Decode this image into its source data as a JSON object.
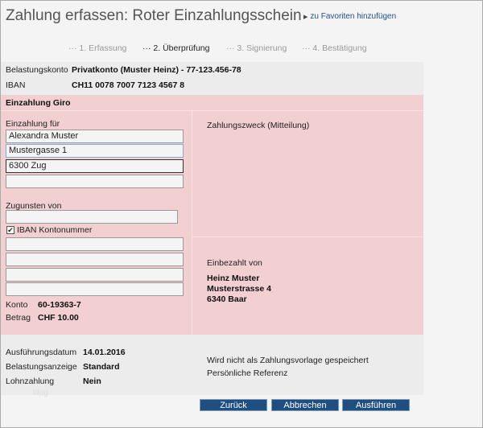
{
  "header": {
    "title": "Zahlung erfassen: Roter Einzahlungsschein",
    "favorite_link": "zu Favoriten hinzufügen"
  },
  "steps": [
    {
      "label": "1. Erfassung",
      "active": false
    },
    {
      "label": "2. Überprüfung",
      "active": true
    },
    {
      "label": "3. Signierung",
      "active": false
    },
    {
      "label": "4. Bestätigung",
      "active": false
    }
  ],
  "account": {
    "debit_label": "Belastungskonto",
    "debit_value": "Privatkonto (Muster Heinz) - 77-123.456-78",
    "iban_label": "IBAN",
    "iban_value": "CH11 0078 7007 7123 4567 8"
  },
  "section_title": "Einzahlung Giro",
  "payee": {
    "label": "Einzahlung für",
    "lines": [
      "Alexandra Muster",
      "Mustergasse 1",
      "6300 Zug",
      ""
    ]
  },
  "beneficiary": {
    "label": "Zugunsten von",
    "value": "",
    "iban_checkbox_label": "IBAN Kontonummer",
    "iban_checked": true,
    "lines": [
      "",
      "",
      "",
      ""
    ]
  },
  "konto": {
    "label": "Konto",
    "value": "60-19363-7"
  },
  "betrag": {
    "label": "Betrag",
    "value": "CHF 10.00"
  },
  "purpose": {
    "label": "Zahlungszweck (Mitteilung)"
  },
  "payer": {
    "label": "Einbezahlt von",
    "lines": [
      "Heinz Muster",
      "Musterstrasse 4",
      "6340 Baar"
    ]
  },
  "details": [
    {
      "label": "Ausführungsdatum",
      "value": "14.01.2016"
    },
    {
      "label": "Belastungsanzeige",
      "value": "Standard"
    },
    {
      "label": "Lohnzahlung",
      "value": "Nein"
    }
  ],
  "notes": {
    "template": "Wird nicht als Zahlungsvorlage gespeichert",
    "reference": "Persönliche Referenz"
  },
  "watermark": "blog",
  "buttons": {
    "back": "Zurück",
    "cancel": "Abbrechen",
    "execute": "Ausführen"
  }
}
